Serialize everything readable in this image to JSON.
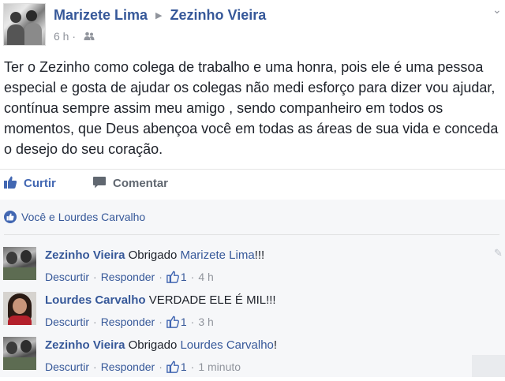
{
  "post": {
    "author": "Marizete Lima",
    "target": "Zezinho Vieira",
    "time": "6 h",
    "audience_icon": "friends-icon",
    "text": "Ter o Zezinho como colega de trabalho e uma honra, pois ele é uma pessoa especial e gosta de ajudar os colegas não medi esforço para dizer vou ajudar, contínua sempre assim meu amigo , sendo companheiro em todos os momentos, que Deus abençoa você em todas as áreas de sua vida e conceda o desejo do seu coração."
  },
  "actions": {
    "like_label": "Curtir",
    "comment_label": "Comentar"
  },
  "likes": {
    "summary": "Você e Lourdes Carvalho"
  },
  "comments": [
    {
      "author": "Zezinho Vieira",
      "text_prefix": "Obrigado ",
      "mention": "Marizete Lima",
      "text_suffix": "!!!",
      "unlike": "Descurtir",
      "reply": "Responder",
      "likes": "1",
      "time": "4 h"
    },
    {
      "author": "Lourdes Carvalho",
      "text_prefix": "VERDADE ELE É MIL!!!",
      "mention": "",
      "text_suffix": "",
      "unlike": "Descurtir",
      "reply": "Responder",
      "likes": "1",
      "time": "3 h"
    },
    {
      "author": "Zezinho Vieira",
      "text_prefix": "Obrigado ",
      "mention": "Lourdes Carvalho",
      "text_suffix": "!",
      "unlike": "Descurtir",
      "reply": "Responder",
      "likes": "1",
      "time": "1 minuto"
    }
  ],
  "colors": {
    "link": "#365899",
    "like_active": "#4267b2",
    "muted": "#90949c",
    "comments_bg": "#f6f7f9"
  }
}
